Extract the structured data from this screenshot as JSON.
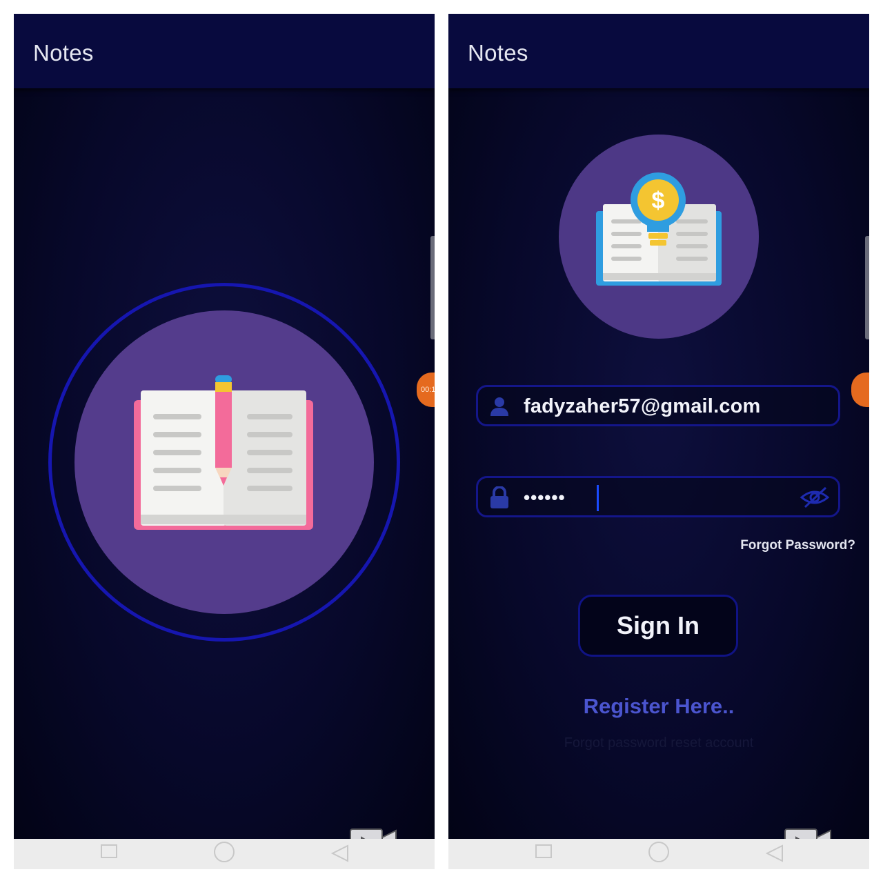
{
  "left_screen": {
    "appbar": {
      "title": "Notes"
    },
    "indicator": {
      "rec_label": "00:1"
    }
  },
  "right_screen": {
    "appbar": {
      "title": "Notes"
    },
    "login": {
      "email_value": "fadyzaher57@gmail.com",
      "password_masked": "••••••",
      "forgot_label": "Forgot Password?",
      "signin_label": "Sign In",
      "register_label": "Register Here..",
      "faint_label": "Forgot password reset account"
    }
  },
  "colors": {
    "background_dark": "#07082a",
    "appbar": "#080a3e",
    "circle_purple": "#543c8c",
    "ring_blue": "#1616b0",
    "register_link": "#4b55cf",
    "book_pink": "#f36b9a",
    "book_blue": "#2f9de0",
    "bulb_yellow": "#f4c531"
  },
  "icons": {
    "user": "user-icon",
    "lock": "lock-icon",
    "eye_off": "eye-off-icon",
    "nav_recents": "square-icon",
    "nav_home": "circle-icon",
    "nav_back": "triangle-back-icon",
    "screen_recorder": "video-camera-icon"
  }
}
